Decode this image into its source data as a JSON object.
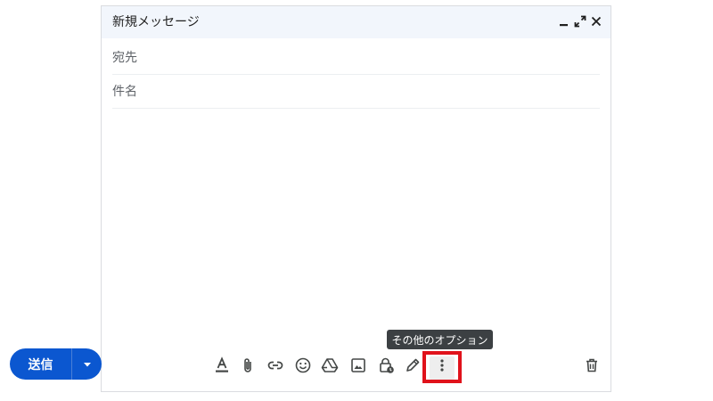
{
  "compose": {
    "title": "新規メッセージ",
    "to_label": "宛先",
    "subject_label": "件名",
    "send_label": "送信",
    "tooltip": "その他のオプション",
    "header_buttons": [
      "minimize-icon",
      "fullscreen-icon",
      "close-icon"
    ],
    "toolbar_icons": [
      "text-format-icon",
      "attach-icon",
      "link-icon",
      "emoji-icon",
      "drive-icon",
      "photo-icon",
      "confidential-mode-icon",
      "signature-icon",
      "more-options-icon",
      "delete-icon"
    ],
    "colors": {
      "send_button": "#0b57d0",
      "header_bg": "#f2f6fc",
      "highlight": "#e0121b",
      "tooltip_bg": "#3c4043",
      "icon": "#444746"
    }
  }
}
